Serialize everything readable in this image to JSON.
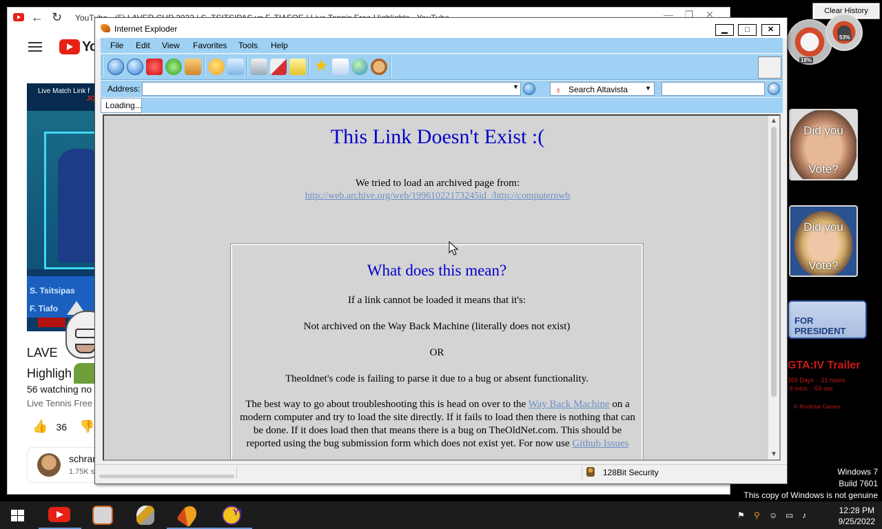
{
  "background_browser": {
    "tab_title": "YouTube - (5) LAVER CUP 2022 | S. TSITSIPAS vs F. TIAFOE | Live Tennis Free Highlights - YouTube",
    "window_buttons": [
      "—",
      "❐",
      "✕"
    ],
    "youtube": {
      "wordmark": "You",
      "thumbnail_banner": "Live Match Link f",
      "thumbnail_tag": "JO",
      "player1": "S. Tsitsipas",
      "player2": "F. Tiafo",
      "video_title_line1": "LAVE",
      "video_title_line2": "Highligh",
      "watching": "56 watching no",
      "channel": "Live Tennis Free",
      "likes": "36",
      "subscriber_name": "schrar",
      "subscriber_count": "1.75K s"
    }
  },
  "desktop": {
    "clear_history": "Clear History",
    "meter_pct_1": "53%",
    "meter_pct_2": "18%",
    "vote_cards": [
      {
        "line1": "Did you",
        "line2": "Vote?"
      },
      {
        "line1": "Did you",
        "line2": "Vote?"
      }
    ],
    "president": "FOR PRESIDENT",
    "gta": {
      "title": "GTA:IV Trailer",
      "days": "359 Days : -21 hours",
      "mins": ".9 mins : -59 sec",
      "rockstar": "© Rockstar Games"
    },
    "watermark": [
      "Windows 7",
      "Build 7601",
      "This copy of Windows is not genuine"
    ]
  },
  "ie": {
    "title": "Internet Exploder",
    "window_buttons": {
      "minimize": "▁",
      "maximize": "□",
      "close": "✕"
    },
    "menu": [
      "File",
      "Edit",
      "View",
      "Favorites",
      "Tools",
      "Help"
    ],
    "address_label": "Address:",
    "address_value": "",
    "search_engine": "Search Altavista",
    "search_value": "",
    "loading_tab": "Loading...",
    "page": {
      "title": "This Link Doesn't Exist :(",
      "tried": "We tried to load an archived page from:",
      "link": "http://web.archive.org/web/19961022173245id_/http://computernwb",
      "mean_title": "What does this mean?",
      "mean_line1": "If a link cannot be loaded it means that it's:",
      "mean_line2": "Not archived on the Way Back Machine (literally does not exist)",
      "mean_or": "OR",
      "mean_line3": "Theoldnet's code is failing to parse it due to a bug or absent functionality.",
      "para_start": "The best way to go about troubleshooting this is head on over to the ",
      "para_link1": "Way Back Machine",
      "para_mid": " on a modern computer and try to load the site directly. If it fails to load then there is nothing that can be done. If it does load then that means there is a bug on TheOldNet.com. This should be reported using the bug submission form which does not exist yet. For now use ",
      "para_link2": "Github Issues"
    },
    "status_security": "128Bit Security"
  },
  "taskbar": {
    "time": "12:28 PM",
    "date": "9/25/2022"
  }
}
